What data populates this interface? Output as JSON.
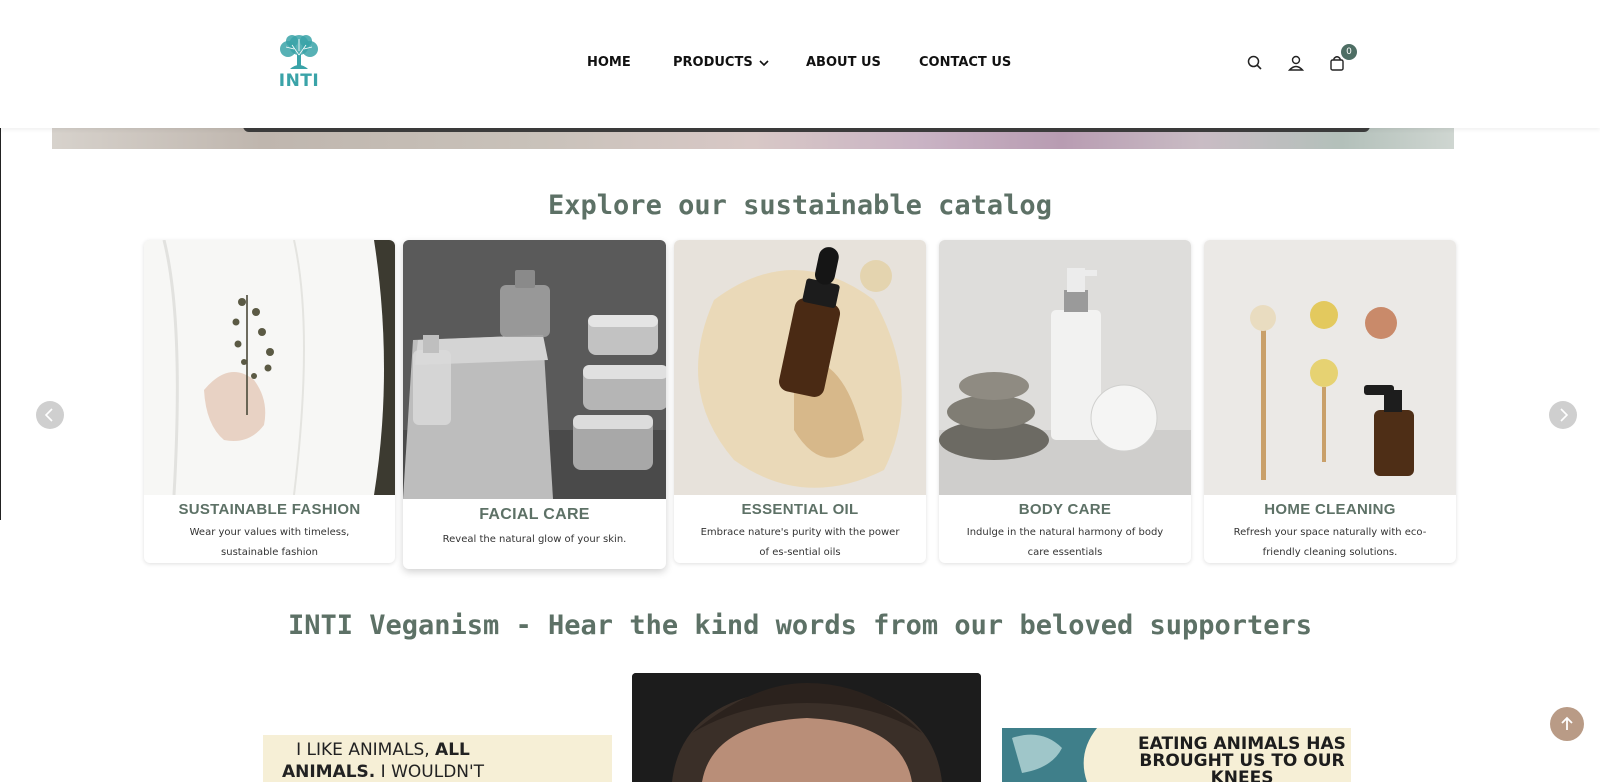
{
  "brand": {
    "logo_text": "INTI"
  },
  "nav": {
    "home": "HOME",
    "products": "PRODUCTS",
    "about": "ABOUT US",
    "contact": "CONTACT US"
  },
  "header_icons": {
    "search": "search-icon",
    "account": "user-icon",
    "cart": "shopping-bag-icon"
  },
  "cart": {
    "count": "0"
  },
  "catalog": {
    "title": "Explore our sustainable catalog",
    "cards": [
      {
        "title": "SUSTAINABLE FASHION",
        "description": "Wear your values with timeless, sustainable fashion"
      },
      {
        "title": "FACIAL CARE",
        "description": "Reveal the natural glow of your skin."
      },
      {
        "title": "ESSENTIAL OIL",
        "description": "Embrace nature's purity with the power of es-sential oils"
      },
      {
        "title": "BODY CARE",
        "description": "Indulge in the natural harmony of body care essentials"
      },
      {
        "title": "HOME CLEANING",
        "description": "Refresh your space naturally with eco-friendly cleaning solutions."
      }
    ]
  },
  "testimonials": {
    "title": "INTI Veganism - Hear the kind words from our beloved supporters",
    "quote_left": {
      "a": "I LIKE ANIMALS, ",
      "b": "ALL",
      "c": "ANIMALS.",
      "d": " I WOULDN'T"
    },
    "quote_right": "EATING ANIMALS HAS BROUGHT US TO OUR KNEES"
  },
  "colors": {
    "accent": "#5d7166",
    "logo": "#3aa3a8",
    "back_to_top": "#b99b86"
  }
}
